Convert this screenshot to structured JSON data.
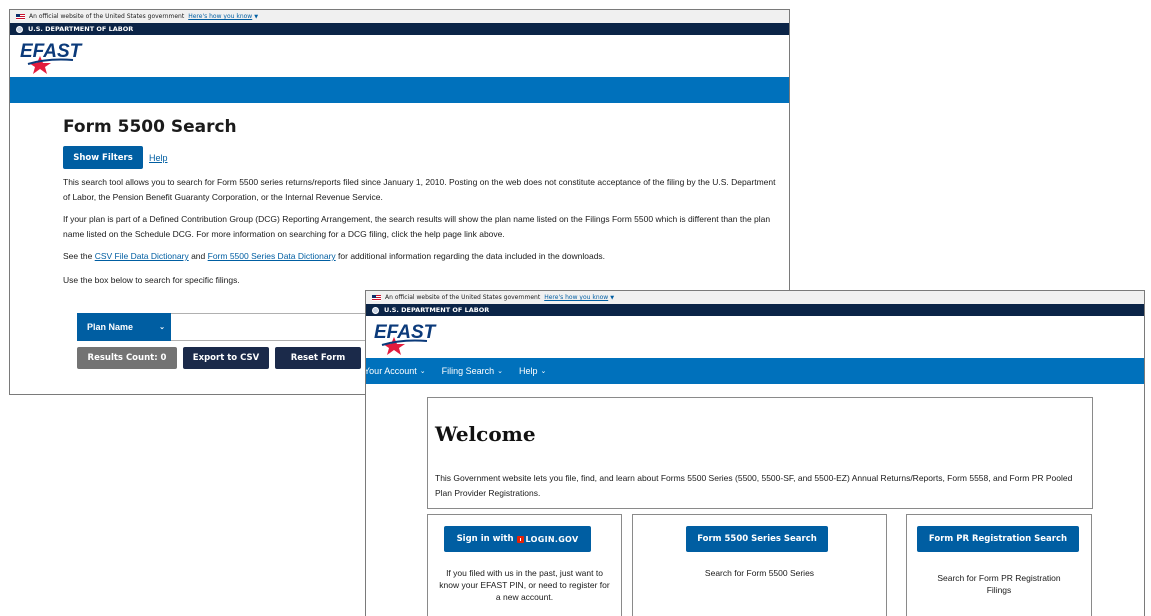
{
  "window1": {
    "gov_banner": {
      "text": "An official website of the United States government",
      "link": "Here's how you know"
    },
    "agency": "U.S. DEPARTMENT OF LABOR",
    "logo_text": "EFAST",
    "page_title": "Form 5500 Search",
    "show_filters_label": "Show Filters",
    "help_label": "Help",
    "para1": "This search tool allows you to search for Form 5500 series returns/reports filed since January 1, 2010. Posting on the web does not constitute acceptance of the filing by the U.S. Department of Labor, the Pension Benefit Guaranty Corporation, or the Internal Revenue Service.",
    "para2": "If your plan is part of a Defined Contribution Group (DCG) Reporting Arrangement, the search results will show the plan name listed on the Filings Form 5500 which is different than the plan name listed on the Schedule DCG. For more information on searching for a DCG filing, click the help page link above.",
    "para3": {
      "before": "See the",
      "link1": "CSV File Data Dictionary",
      "middle": "and",
      "link2": "Form 5500 Series Data Dictionary",
      "after": "for additional information regarding the data included in the downloads."
    },
    "para4": "Use the box below to search for specific filings.",
    "search_field_select": "Plan Name",
    "search_value": "",
    "results_count_label": "Results Count: 0",
    "export_label": "Export to CSV",
    "reset_label": "Reset Form"
  },
  "window2": {
    "gov_banner": {
      "text": "An official website of the United States government",
      "link": "Here's how you know"
    },
    "agency": "U.S. DEPARTMENT OF LABOR",
    "logo_text": "EFAST",
    "nav": [
      "Your Account",
      "Filing Search",
      "Help"
    ],
    "welcome_title": "Welcome",
    "welcome_text": "This Government website lets you file, find, and learn about Forms 5500 Series (5500, 5500-SF, and 5500-EZ) Annual Returns/Reports, Form 5558, and Form PR Pooled Plan Provider Registrations.",
    "card1": {
      "button_prefix": "Sign in with",
      "button_brand": "LOGIN.GOV",
      "text": "If you filed with us in the past, just want to know your EFAST PIN, or need to register for a new account."
    },
    "card2": {
      "button": "Form 5500 Series Search",
      "text": "Search for Form 5500 Series"
    },
    "card3": {
      "button": "Form PR Registration Search",
      "text": "Search for Form PR Registration Filings"
    }
  },
  "colors": {
    "nav_blue": "#0071bc",
    "button_blue": "#005ea2",
    "dark_navy": "#0b2447",
    "button_dark": "#1b2a4a",
    "button_gray": "#737373",
    "logo_red": "#e31c3d"
  }
}
